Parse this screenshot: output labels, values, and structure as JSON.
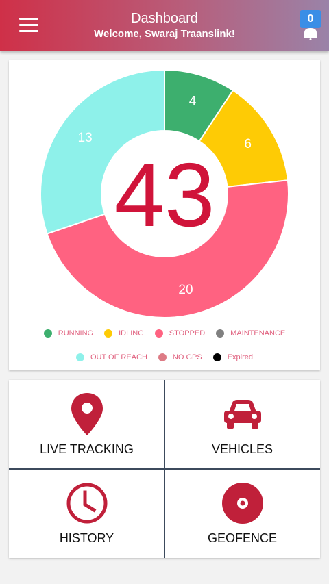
{
  "header": {
    "title": "Dashboard",
    "subtitle": "Welcome, Swaraj Traanslink!",
    "notification_count": "0",
    "menu_icon": "hamburger-menu-icon",
    "bell_icon": "bell-icon"
  },
  "chart_data": {
    "type": "pie",
    "style": "donut",
    "center_label": "43",
    "categories": [
      "RUNNING",
      "IDLING",
      "STOPPED",
      "OUT OF REACH"
    ],
    "values": [
      4,
      6,
      20,
      13
    ],
    "colors": [
      "#3daf6e",
      "#fecb05",
      "#ff6281",
      "#8ef1ea"
    ],
    "legend": [
      {
        "label": "RUNNING",
        "color": "#3daf6e"
      },
      {
        "label": "IDLING",
        "color": "#fecb05"
      },
      {
        "label": "STOPPED",
        "color": "#ff6281"
      },
      {
        "label": "MAINTENANCE",
        "color": "#808080"
      },
      {
        "label": "OUT OF REACH",
        "color": "#8ef1ea"
      },
      {
        "label": "NO GPS",
        "color": "#dd7b85"
      },
      {
        "label": "Expired",
        "color": "#000000"
      }
    ],
    "legend_position": "bottom"
  },
  "menu": {
    "tiles": [
      {
        "label": "LIVE TRACKING",
        "icon": "map-pin-icon"
      },
      {
        "label": "VEHICLES",
        "icon": "car-icon"
      },
      {
        "label": "HISTORY",
        "icon": "clock-icon"
      },
      {
        "label": "GEOFENCE",
        "icon": "geofence-disc-icon"
      }
    ],
    "icon_color": "#c0203a"
  }
}
